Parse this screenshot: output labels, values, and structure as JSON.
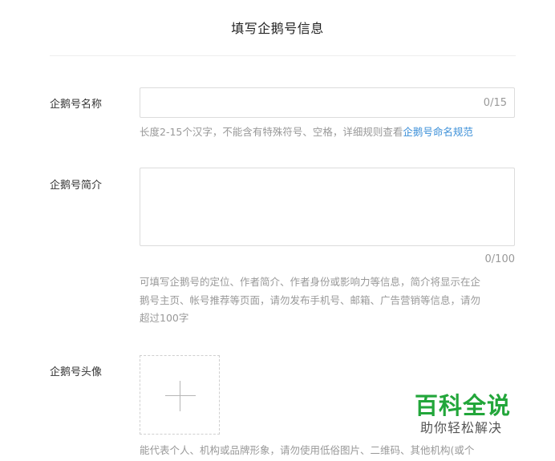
{
  "page": {
    "title": "填写企鹅号信息"
  },
  "fields": {
    "name": {
      "label": "企鹅号名称",
      "value": "",
      "counter": "0/15",
      "hint_text": "长度2-15个汉字，不能含有特殊符号、空格，详细规则查看",
      "hint_link": "企鹅号命名规范"
    },
    "intro": {
      "label": "企鹅号简介",
      "value": "",
      "counter": "0/100",
      "hint_line1": "可填写企鹅号的定位、作者简介、作者身份或影响力等信息，简介将显示在企",
      "hint_line2": "鹅号主页、帐号推荐等页面，请勿发布手机号、邮箱、广告营销等信息，请勿",
      "hint_line3": "超过100字"
    },
    "avatar": {
      "label": "企鹅号头像",
      "upload_icon": "plus-icon",
      "hint_line1": "能代表个人、机构或品牌形象，请勿使用低俗图片、二维码、其他机构(或个"
    }
  },
  "watermark": {
    "logo": "百科全说",
    "sub": "助你轻松解决"
  },
  "colors": {
    "link": "#3b8fd8",
    "watermark": "#22a63a",
    "border": "#dcdcdc",
    "hint": "#999999"
  }
}
